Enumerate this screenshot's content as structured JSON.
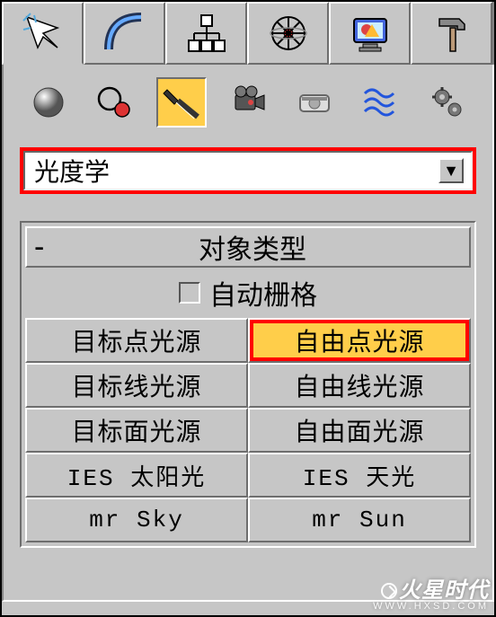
{
  "main_tabs": [
    {
      "name": "select-arrow"
    },
    {
      "name": "arc"
    },
    {
      "name": "hierarchy"
    },
    {
      "name": "motion"
    },
    {
      "name": "display"
    },
    {
      "name": "utilities"
    }
  ],
  "sub_tools": [
    {
      "name": "geometry-sphere"
    },
    {
      "name": "shapes"
    },
    {
      "name": "lights",
      "active": true
    },
    {
      "name": "cameras"
    },
    {
      "name": "helpers"
    },
    {
      "name": "space-warps"
    },
    {
      "name": "systems"
    }
  ],
  "dropdown": {
    "selected": "光度学"
  },
  "rollout": {
    "title": "对象类型",
    "autogrid_label": "自动栅格",
    "buttons": [
      {
        "label": "目标点光源"
      },
      {
        "label": "自由点光源",
        "highlighted": true
      },
      {
        "label": "目标线光源"
      },
      {
        "label": "自由线光源"
      },
      {
        "label": "目标面光源"
      },
      {
        "label": "自由面光源"
      },
      {
        "label": "IES 太阳光",
        "en": true
      },
      {
        "label": "IES 天光",
        "en": true
      },
      {
        "label": "mr Sky",
        "en": true
      },
      {
        "label": "mr Sun",
        "en": true
      }
    ]
  },
  "watermark": {
    "brand": "火星时代",
    "url": "WWW.HXSD.COM"
  }
}
